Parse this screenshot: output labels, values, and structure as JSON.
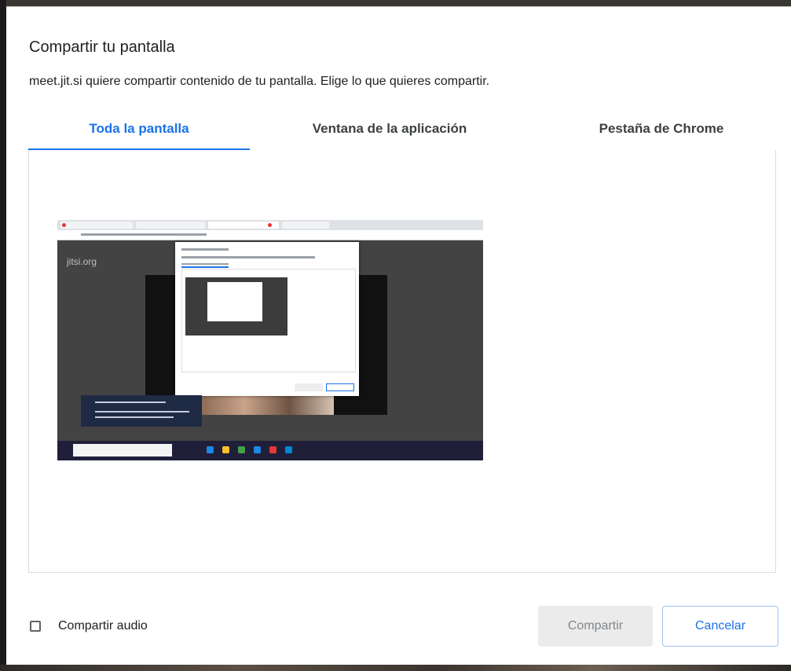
{
  "dialog": {
    "title": "Compartir tu pantalla",
    "subtitle": "meet.jit.si quiere compartir contenido de tu pantalla. Elige lo que quieres compartir."
  },
  "tabs": [
    {
      "label": "Toda la pantalla",
      "active": true
    },
    {
      "label": "Ventana de la aplicación",
      "active": false
    },
    {
      "label": "Pestaña de Chrome",
      "active": false
    }
  ],
  "preview": {
    "logo_text": "jitsi.org"
  },
  "footer": {
    "checkbox_label": "Compartir audio",
    "checkbox_checked": false,
    "share_label": "Compartir",
    "cancel_label": "Cancelar"
  },
  "colors": {
    "accent": "#1a73e8",
    "share_disabled_bg": "#ebebeb"
  }
}
